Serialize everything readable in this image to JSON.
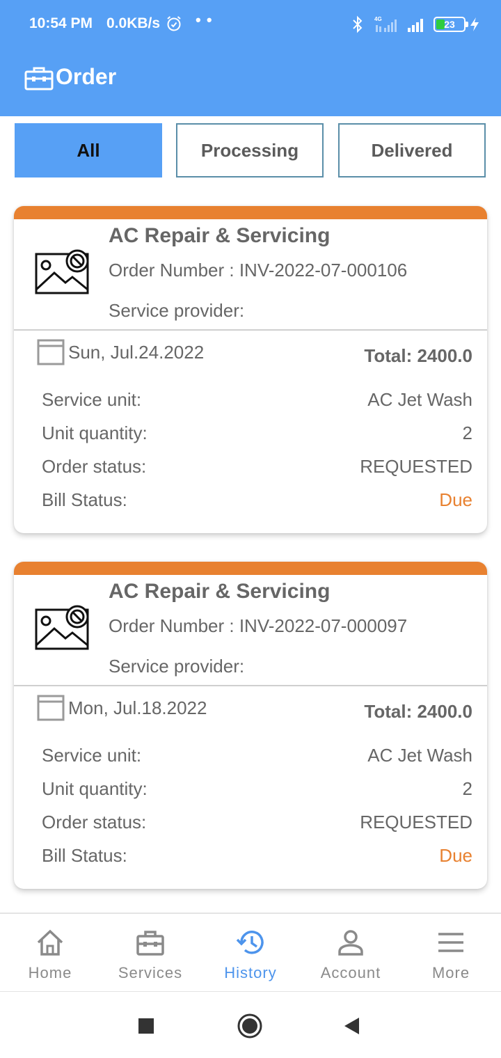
{
  "status_bar": {
    "time": "10:54 PM",
    "net_speed": "0.0KB/s",
    "dots": "• •",
    "network_type": "4G",
    "battery_level": "23",
    "icons": [
      "alarm-icon",
      "bluetooth-icon",
      "signal-4g-icon",
      "signal-icon",
      "battery-icon",
      "charging-icon"
    ]
  },
  "app_bar": {
    "title": "Order",
    "icon": "briefcase-icon",
    "background": "#57a0f5"
  },
  "filters": {
    "all": "All",
    "processing": "Processing",
    "delivered": "Delivered",
    "selected": "All"
  },
  "colors": {
    "primary": "#57a0f5",
    "accent": "#e88130",
    "active_nav": "#4d94ec",
    "text": "#666666"
  },
  "orders": [
    {
      "title": "AC Repair & Servicing",
      "order_number": "Order Number : INV-2022-07-000106",
      "provider": "Service provider:",
      "date": "Sun, Jul.24.2022",
      "total": "Total: 2400.0",
      "rows": [
        {
          "label": "Service unit:",
          "value": "AC Jet Wash"
        },
        {
          "label": "Unit quantity:",
          "value": "2"
        },
        {
          "label": "Order status:",
          "value": "REQUESTED"
        },
        {
          "label": "Bill Status:",
          "value": "Due"
        }
      ]
    },
    {
      "title": "AC Repair & Servicing",
      "order_number": "Order Number : INV-2022-07-000097",
      "provider": "Service provider:",
      "date": "Mon, Jul.18.2022",
      "total": "Total: 2400.0",
      "rows": [
        {
          "label": "Service unit:",
          "value": "AC Jet Wash"
        },
        {
          "label": "Unit quantity:",
          "value": "2"
        },
        {
          "label": "Order status:",
          "value": "REQUESTED"
        },
        {
          "label": "Bill Status:",
          "value": "Due"
        }
      ]
    }
  ],
  "bottom_nav": {
    "items": [
      {
        "label": "Home",
        "icon": "home-icon"
      },
      {
        "label": "Services",
        "icon": "briefcase-icon"
      },
      {
        "label": "History",
        "icon": "history-icon"
      },
      {
        "label": "Account",
        "icon": "account-icon"
      },
      {
        "label": "More",
        "icon": "menu-icon"
      }
    ],
    "active": "History"
  },
  "system_nav": {
    "icons": [
      "recent-apps-icon",
      "home-circle-icon",
      "back-icon"
    ]
  }
}
